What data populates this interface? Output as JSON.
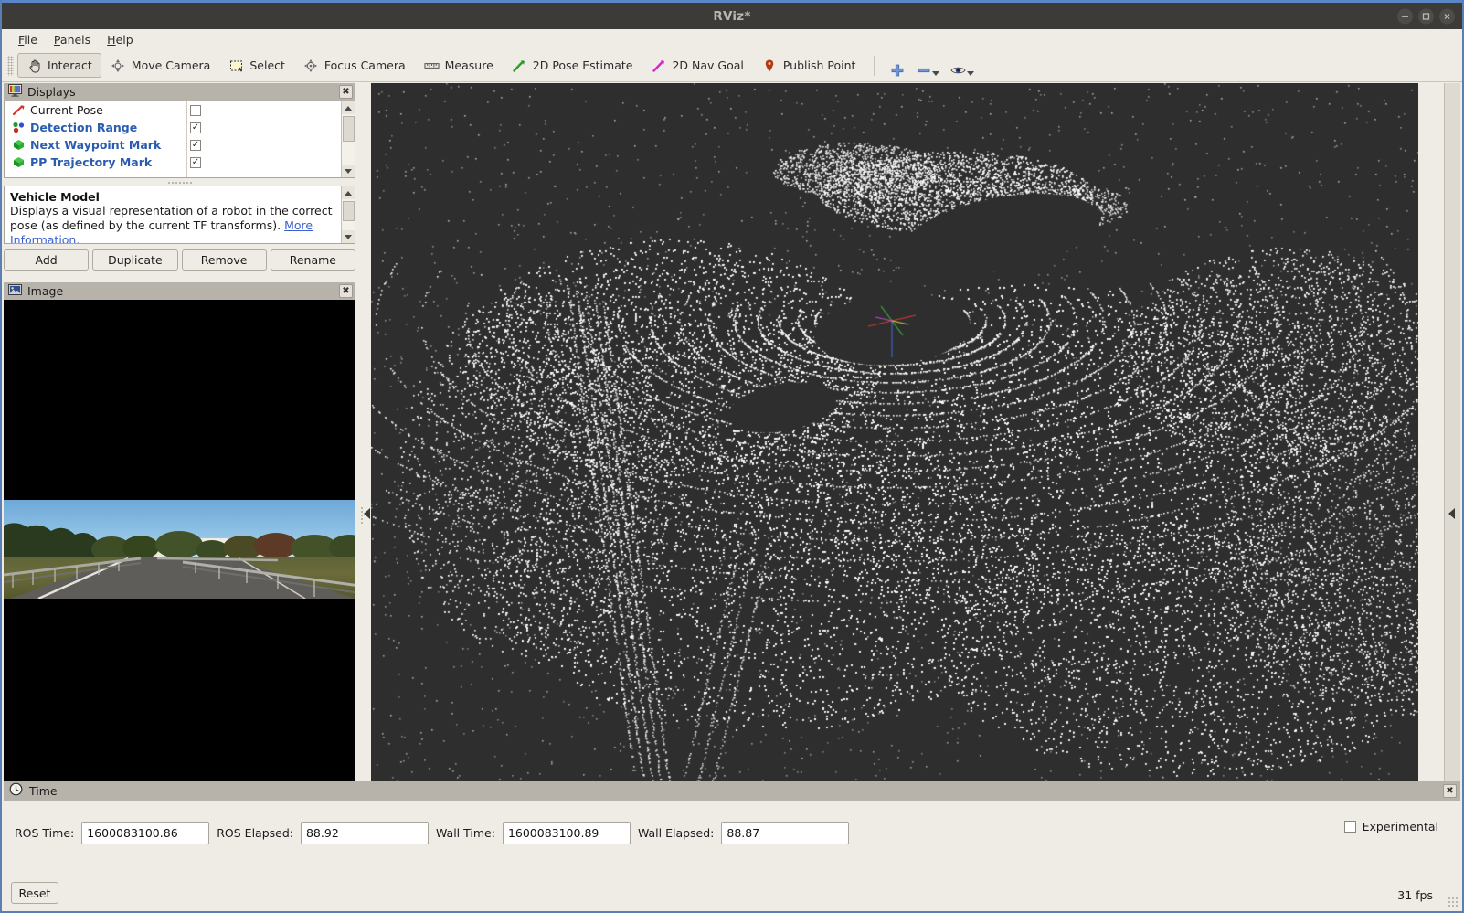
{
  "window": {
    "title": "RViz*",
    "controls": [
      {
        "name": "minimize",
        "glyph": "minimize-icon"
      },
      {
        "name": "maximize",
        "glyph": "maximize-icon"
      },
      {
        "name": "close",
        "glyph": "close-icon"
      }
    ]
  },
  "menubar": {
    "items": [
      {
        "label": "File",
        "mnemonic": "F"
      },
      {
        "label": "Panels",
        "mnemonic": "P"
      },
      {
        "label": "Help",
        "mnemonic": "H"
      }
    ]
  },
  "toolbar": {
    "tools": [
      {
        "label": "Interact",
        "icon": "hand-cursor-icon",
        "active": true
      },
      {
        "label": "Move Camera",
        "icon": "move-camera-icon",
        "active": false
      },
      {
        "label": "Select",
        "icon": "select-rectangle-icon",
        "active": false
      },
      {
        "label": "Focus Camera",
        "icon": "focus-camera-icon",
        "active": false
      },
      {
        "label": "Measure",
        "icon": "ruler-icon",
        "active": false
      },
      {
        "label": "2D Pose Estimate",
        "icon": "green-arrow-icon",
        "active": false
      },
      {
        "label": "2D Nav Goal",
        "icon": "magenta-arrow-icon",
        "active": false
      },
      {
        "label": "Publish Point",
        "icon": "map-pin-icon",
        "active": false
      }
    ],
    "extras": [
      {
        "icon": "plus-icon",
        "label": "",
        "caret": false
      },
      {
        "icon": "minus-icon",
        "label": "",
        "caret": true
      },
      {
        "icon": "eye-icon",
        "label": "",
        "caret": true
      }
    ]
  },
  "displays_panel": {
    "title": "Displays",
    "icon": "displays-panel-icon",
    "close_label": "✖",
    "tree": [
      {
        "label": "Current Pose",
        "icon": "pose-arrow-icon",
        "checked": false,
        "highlighted": false
      },
      {
        "label": "Detection Range",
        "icon": "markers-icon",
        "checked": true,
        "highlighted": true
      },
      {
        "label": "Next Waypoint Mark",
        "icon": "green-cube-icon",
        "checked": true,
        "highlighted": true
      },
      {
        "label": "PP Trajectory Mark",
        "icon": "green-cube-icon",
        "checked": true,
        "highlighted": true
      }
    ],
    "description": {
      "title": "Vehicle Model",
      "body": "Displays a visual representation of a robot in the correct pose (as defined by the current TF transforms).",
      "link": "More Information."
    },
    "buttons": [
      {
        "label": "Add"
      },
      {
        "label": "Duplicate"
      },
      {
        "label": "Remove"
      },
      {
        "label": "Rename"
      }
    ]
  },
  "image_panel": {
    "title": "Image",
    "icon": "image-panel-icon",
    "close_label": "✖"
  },
  "time_panel": {
    "title": "Time",
    "icon": "clock-icon",
    "close_label": "✖",
    "fields": [
      {
        "label": "ROS Time:",
        "value": "1600083100.86"
      },
      {
        "label": "ROS Elapsed:",
        "value": "88.92"
      },
      {
        "label": "Wall Time:",
        "value": "1600083100.89"
      },
      {
        "label": "Wall Elapsed:",
        "value": "88.87"
      }
    ],
    "experimental": {
      "label": "Experimental",
      "checked": false
    },
    "fps": "31 fps",
    "reset_label": "Reset"
  },
  "colors": {
    "titlebar_bg": "#3c3b37",
    "titlebar_accent": "#5b85c6",
    "chrome_bg": "#efece6",
    "panel_header_bg": "#b7b3ab",
    "tree_highlight": "#2a5db0",
    "viewport_bg": "#2e2e2e",
    "pointcloud": "#ffffff",
    "link": "#3a5fcd"
  }
}
